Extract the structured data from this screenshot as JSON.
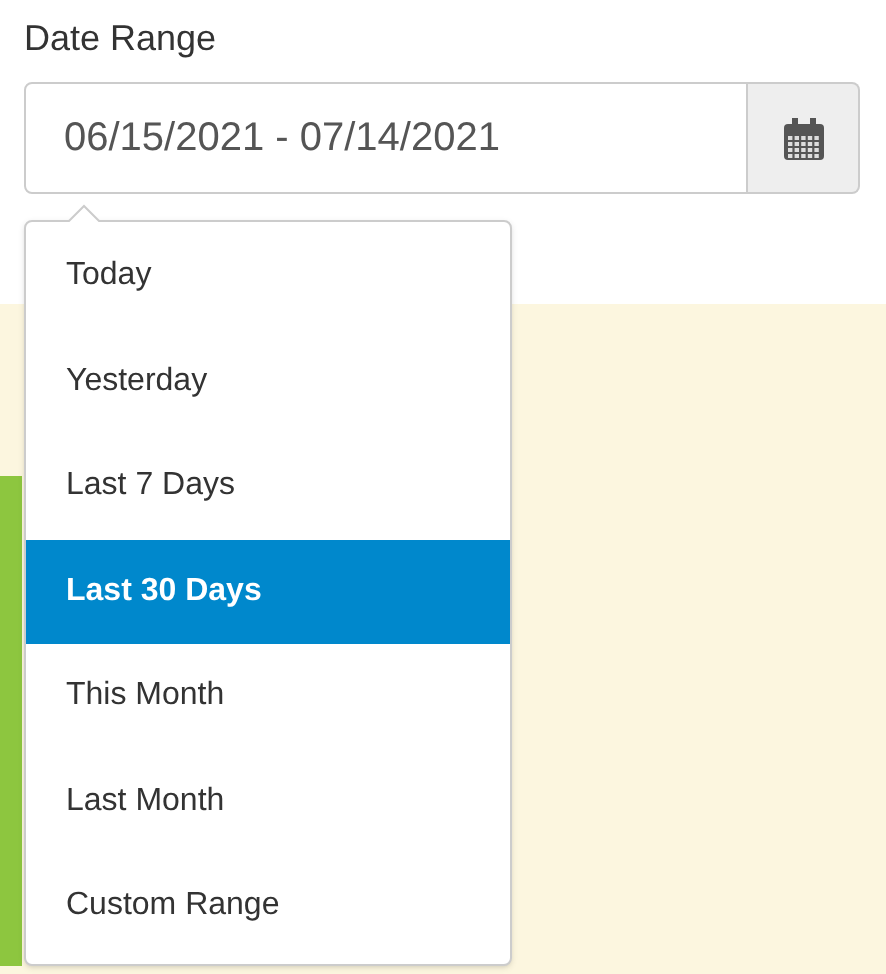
{
  "label": "Date Range",
  "date_field": {
    "value": "06/15/2021 - 07/14/2021"
  },
  "ranges": [
    {
      "label": "Today",
      "selected": false
    },
    {
      "label": "Yesterday",
      "selected": false
    },
    {
      "label": "Last 7 Days",
      "selected": false
    },
    {
      "label": "Last 30 Days",
      "selected": true
    },
    {
      "label": "This Month",
      "selected": false
    },
    {
      "label": "Last Month",
      "selected": false
    },
    {
      "label": "Custom Range",
      "selected": false
    }
  ]
}
